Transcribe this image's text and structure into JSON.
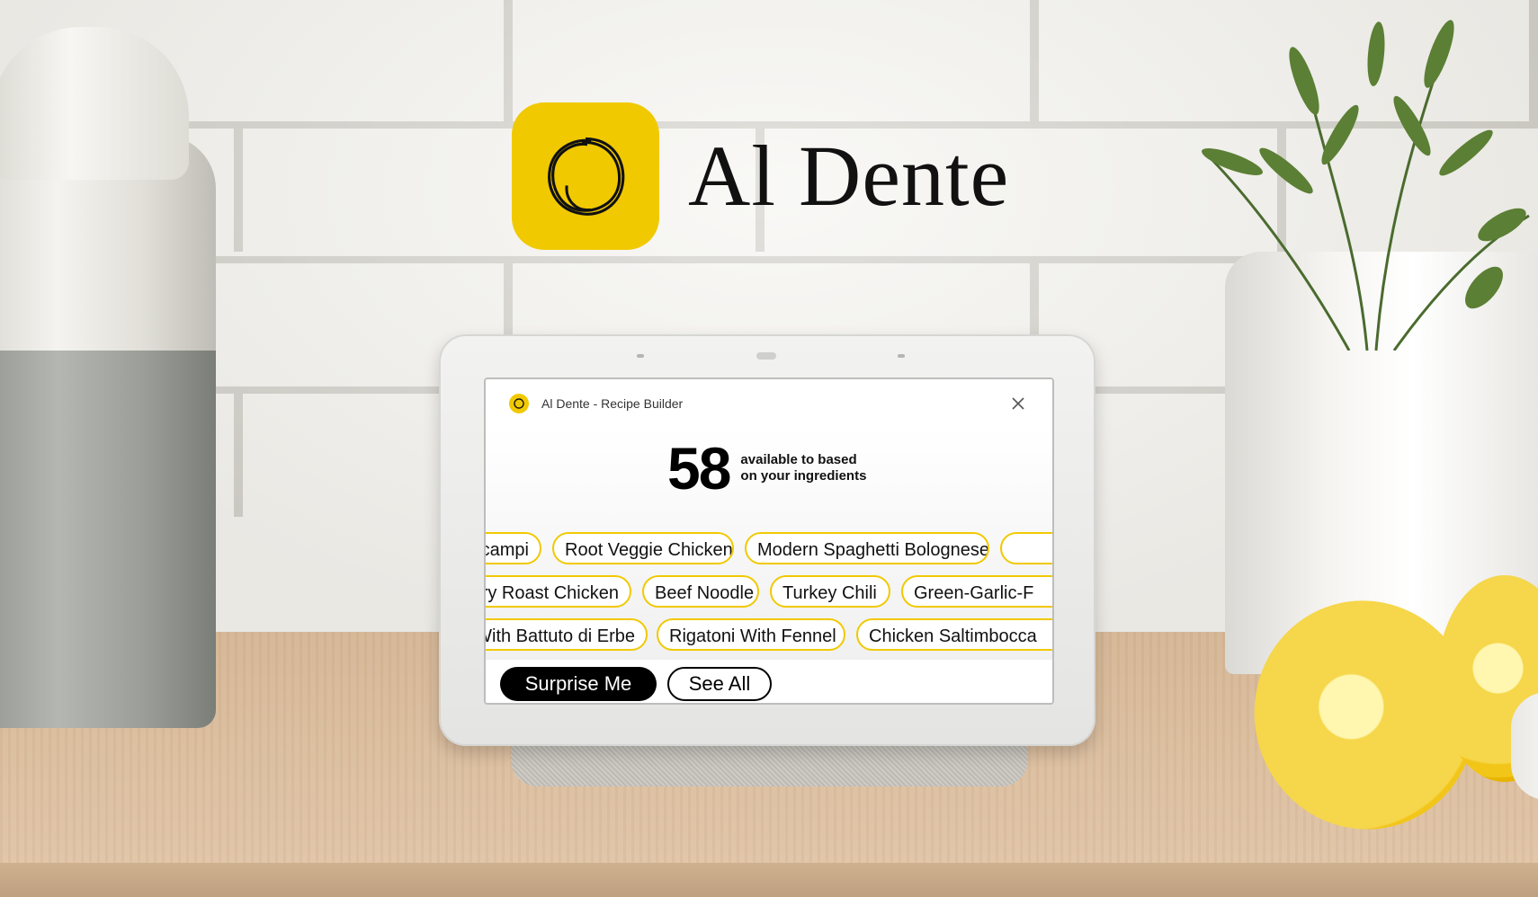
{
  "brand": {
    "name": "Al Dente",
    "accent_color": "#f1c900",
    "icon": "scribble-circle-icon"
  },
  "window": {
    "title": "Al Dente - Recipe Builder",
    "close_icon": "close-icon"
  },
  "summary": {
    "count": "58",
    "description_line1": "available to based",
    "description_line2": "on your ingredients"
  },
  "recipe_rows": [
    [
      "campi",
      "Root Veggie Chicken",
      "Modern Spaghetti Bolognese",
      ""
    ],
    [
      "ery Roast Chicken",
      "Beef Noodle",
      "Turkey Chili",
      "Green-Garlic-F"
    ],
    [
      "With Battuto di Erbe",
      "Rigatoni With Fennel",
      "Chicken Saltimbocca"
    ]
  ],
  "actions": {
    "primary_label": "Surprise Me",
    "secondary_label": "See All"
  }
}
